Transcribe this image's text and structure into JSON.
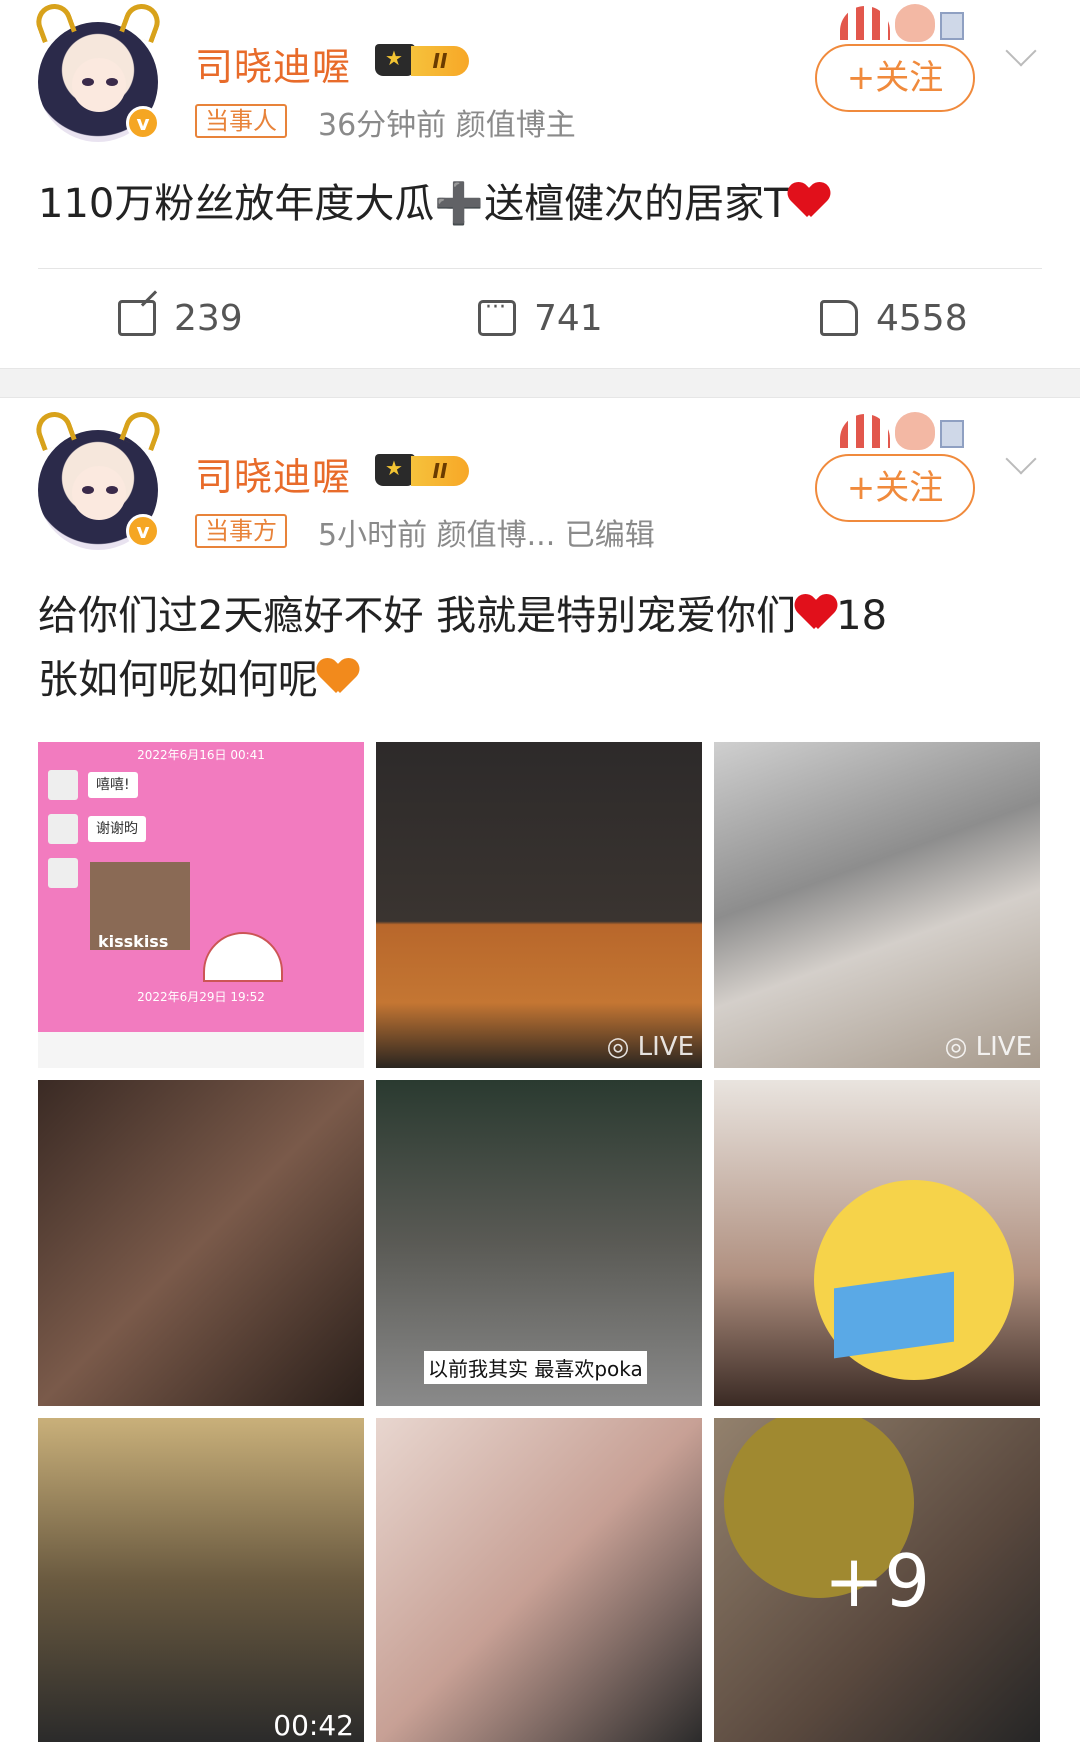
{
  "posts": [
    {
      "username": "司晓迪喔",
      "tag": "当事人",
      "meta": "36分钟前  颜值博主",
      "follow_label": "+关注",
      "content": "110万粉丝放年度大瓜",
      "content_plus": "➕",
      "content_tail": "送檀健次的居家T",
      "actions": {
        "repost": "239",
        "comment": "741",
        "like": "4558"
      }
    },
    {
      "username": "司晓迪喔",
      "tag": "当事方",
      "meta": "5小时前  颜值博...  已编辑",
      "follow_label": "+关注",
      "content_line1": "给你们过2天瘾好不好 我就是特别宠爱你们",
      "content_line1_tail": "18",
      "content_line2": "张如何呢如何呢",
      "images": [
        {
          "chat_date1": "2022年6月16日 00:41",
          "bubble1": "嘻嘻!",
          "bubble2": "谢谢昀",
          "caption": "kisskiss",
          "chat_date2": "2022年6月29日 19:52"
        },
        {
          "live": "LIVE"
        },
        {
          "live": "LIVE"
        },
        {},
        {
          "subtitle": "以前我其实 最喜欢poka"
        },
        {},
        {
          "duration": "00:42"
        },
        {},
        {
          "more": "+9"
        }
      ]
    }
  ],
  "colors": {
    "accent": "#f08a3c",
    "name": "#e86b2a",
    "heart": "#e1101b"
  }
}
